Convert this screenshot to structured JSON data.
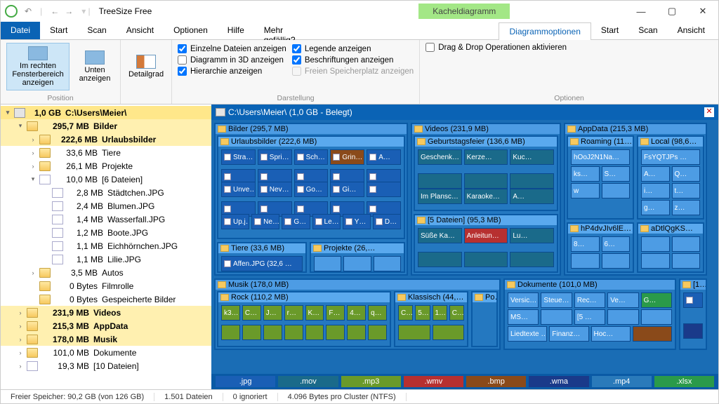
{
  "title": "TreeSize Free",
  "context_tab": "Kacheldiagramm",
  "menu": {
    "file": "Datei",
    "items": [
      "Start",
      "Scan",
      "Ansicht",
      "Optionen",
      "Hilfe",
      "Mehr gefällig?"
    ],
    "active": "Diagrammoptionen"
  },
  "ribbon": {
    "position": {
      "label": "Position",
      "right_pane": "Im rechten Fensterbereich anzeigen",
      "below": "Unten anzeigen"
    },
    "detail": "Detailgrad",
    "display": {
      "label": "Darstellung",
      "c1": [
        "Einzelne Dateien anzeigen",
        "Diagramm in 3D anzeigen",
        "Hierarchie anzeigen"
      ],
      "c1_checked": [
        true,
        false,
        true
      ],
      "c2": [
        "Legende anzeigen",
        "Beschriftungen anzeigen",
        "Freien Speicherplatz anzeigen"
      ],
      "c2_checked": [
        true,
        true,
        false
      ]
    },
    "options": {
      "label": "Optionen",
      "dragdrop": "Drag & Drop Operationen aktivieren"
    }
  },
  "tree": {
    "root": {
      "size": "1,0 GB",
      "path": "C:\\Users\\Meier\\"
    },
    "items": [
      {
        "indent": 1,
        "tw": "▾",
        "ico": "folder",
        "size": "295,7 MB",
        "name": "Bilder",
        "bold": true,
        "hl": true
      },
      {
        "indent": 2,
        "tw": "›",
        "ico": "folder",
        "size": "222,6 MB",
        "name": "Urlaubsbilder",
        "bold": true,
        "hl": true
      },
      {
        "indent": 2,
        "tw": "›",
        "ico": "folder",
        "size": "33,6 MB",
        "name": "Tiere"
      },
      {
        "indent": 2,
        "tw": "›",
        "ico": "folder",
        "size": "26,1 MB",
        "name": "Projekte"
      },
      {
        "indent": 2,
        "tw": "▾",
        "ico": "file",
        "size": "10,0 MB",
        "name": "[6 Dateien]"
      },
      {
        "indent": 3,
        "tw": "",
        "ico": "file",
        "size": "2,8 MB",
        "name": "Städtchen.JPG"
      },
      {
        "indent": 3,
        "tw": "",
        "ico": "file",
        "size": "2,4 MB",
        "name": "Blumen.JPG"
      },
      {
        "indent": 3,
        "tw": "",
        "ico": "file",
        "size": "1,4 MB",
        "name": "Wasserfall.JPG"
      },
      {
        "indent": 3,
        "tw": "",
        "ico": "file",
        "size": "1,2 MB",
        "name": "Boote.JPG"
      },
      {
        "indent": 3,
        "tw": "",
        "ico": "file",
        "size": "1,1 MB",
        "name": "Eichhörnchen.JPG"
      },
      {
        "indent": 3,
        "tw": "",
        "ico": "file",
        "size": "1,1 MB",
        "name": "Lilie.JPG"
      },
      {
        "indent": 2,
        "tw": "›",
        "ico": "folder",
        "size": "3,5 MB",
        "name": "Autos"
      },
      {
        "indent": 2,
        "tw": "",
        "ico": "folder",
        "size": "0 Bytes",
        "name": "Filmrolle"
      },
      {
        "indent": 2,
        "tw": "",
        "ico": "folder",
        "size": "0 Bytes",
        "name": "Gespeicherte Bilder"
      },
      {
        "indent": 1,
        "tw": "›",
        "ico": "folder",
        "size": "231,9 MB",
        "name": "Videos",
        "bold": true,
        "hl": true
      },
      {
        "indent": 1,
        "tw": "›",
        "ico": "folder",
        "size": "215,3 MB",
        "name": "AppData",
        "bold": true,
        "hl": true
      },
      {
        "indent": 1,
        "tw": "›",
        "ico": "folder",
        "size": "178,0 MB",
        "name": "Musik",
        "bold": true,
        "hl": true
      },
      {
        "indent": 1,
        "tw": "›",
        "ico": "folder",
        "size": "101,0 MB",
        "name": "Dokumente"
      },
      {
        "indent": 1,
        "tw": "›",
        "ico": "file",
        "size": "19,3 MB",
        "name": "[10 Dateien]"
      }
    ]
  },
  "treemap": {
    "head": "C:\\Users\\Meier\\ (1,0 GB - Belegt)",
    "bilder": "Bilder (295,7 MB)",
    "urlaub": "Urlaubsbilder (222,6 MB)",
    "urlaub_r1": [
      "Stra…",
      "Spri…",
      "Sch…",
      "Grin…",
      "A…"
    ],
    "urlaub_r2": [
      "Unve…",
      "Nev…",
      "Go…",
      "Gi…",
      ""
    ],
    "urlaub_r3": [
      "Up.j…",
      "Ne…",
      "G…",
      "Le…",
      "Y…",
      "D…"
    ],
    "tiere": "Tiere (33,6 MB)",
    "affen": "Affen.JPG (32,6 …",
    "projekte": "Projekte (26,…",
    "videos": "Videos (231,9 MB)",
    "geb": "Geburtstagsfeier (136,6 MB)",
    "geb_r1": [
      "Geschenk…",
      "Kerze…",
      "Kuc…"
    ],
    "geb_r2": [
      "Im Plansc…",
      "Karaoke…",
      "A…"
    ],
    "dat5": "[5 Dateien]  (95,3 MB)",
    "dat5_r": [
      "Süße Ka…",
      "Anleitun…",
      "Lu…"
    ],
    "appdata": "AppData (215,3 MB)",
    "roaming": "Roaming (11…",
    "roam_r": [
      "hOoJ2N1Na…",
      "ks…",
      "S…",
      "w"
    ],
    "local": "Local (98,6…",
    "local_r": [
      "FsYQTJPs …",
      "A…",
      "Q…",
      "i…",
      "t…",
      "g…",
      "z…"
    ],
    "hp4": "hP4dvJIv6lE…",
    "adt": "aDtlQgKS…",
    "musik": "Musik (178,0 MB)",
    "rock": "Rock (110,2 MB)",
    "rock_r": [
      "k3…",
      "C…",
      "J…",
      "r…",
      "K…",
      "F…",
      "4…",
      "q…"
    ],
    "klassisch": "Klassisch (44,…",
    "klas_r": [
      "C…",
      "5…",
      "1…",
      "C…"
    ],
    "po": "Po…",
    "dok": "Dokumente (101,0 MB)",
    "dok_r1": [
      "Versic…",
      "Steue…",
      "Rec…",
      "Ve…",
      "G…"
    ],
    "dok_r2": [
      "MS…",
      "",
      "[5 …",
      "",
      ""
    ],
    "dok_r3": [
      "Liedtexte …",
      "Finanz…",
      "Hoc…",
      ""
    ],
    "one": "[1…",
    "legend": [
      {
        "label": ".jpg",
        "color": "#1a5fb5"
      },
      {
        "label": ".mov",
        "color": "#1a6a8a"
      },
      {
        "label": ".mp3",
        "color": "#6a9a2a"
      },
      {
        "label": ".wmv",
        "color": "#b73030"
      },
      {
        "label": ".bmp",
        "color": "#8a4a1a"
      },
      {
        "label": ".wma",
        "color": "#1a3a8a"
      },
      {
        "label": ".mp4",
        "color": "#2a7aba"
      },
      {
        "label": ".xlsx",
        "color": "#2a9a4a"
      }
    ]
  },
  "status": {
    "free": "Freier Speicher: 90,2 GB  (von 126 GB)",
    "files": "1.501 Dateien",
    "ignored": "0 ignoriert",
    "cluster": "4.096 Bytes pro Cluster (NTFS)"
  }
}
